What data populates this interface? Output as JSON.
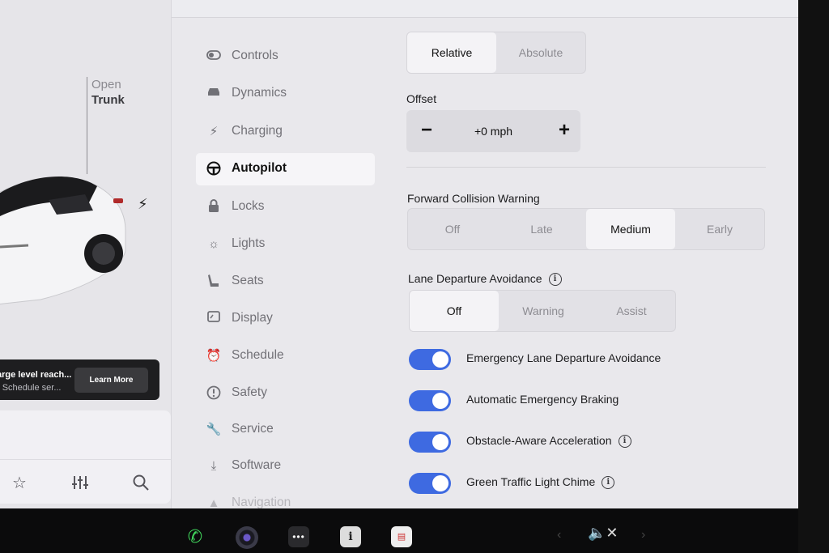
{
  "car_panel": {
    "trunk_status": "Open",
    "trunk_label": "Trunk",
    "notification": {
      "title": "arge level reach...",
      "subtitle": "- Schedule ser...",
      "button": "Learn More"
    },
    "media_icons": [
      "star-icon",
      "equalizer-icon",
      "search-icon"
    ]
  },
  "nav": {
    "items": [
      {
        "label": "Controls",
        "icon": "toggle-icon",
        "active": false
      },
      {
        "label": "Dynamics",
        "icon": "car-icon",
        "active": false
      },
      {
        "label": "Charging",
        "icon": "bolt-icon",
        "active": false
      },
      {
        "label": "Autopilot",
        "icon": "steering-wheel-icon",
        "active": true
      },
      {
        "label": "Locks",
        "icon": "lock-icon",
        "active": false
      },
      {
        "label": "Lights",
        "icon": "light-icon",
        "active": false
      },
      {
        "label": "Seats",
        "icon": "seat-icon",
        "active": false
      },
      {
        "label": "Display",
        "icon": "display-icon",
        "active": false
      },
      {
        "label": "Schedule",
        "icon": "alarm-icon",
        "active": false
      },
      {
        "label": "Safety",
        "icon": "alert-icon",
        "active": false
      },
      {
        "label": "Service",
        "icon": "wrench-icon",
        "active": false
      },
      {
        "label": "Software",
        "icon": "download-icon",
        "active": false
      },
      {
        "label": "Navigation",
        "icon": "navigation-icon",
        "active": false
      }
    ]
  },
  "autopilot": {
    "speed_limit_mode": {
      "options": [
        "Relative",
        "Absolute"
      ],
      "selected": "Relative"
    },
    "offset": {
      "label": "Offset",
      "value": "+0 mph",
      "minus": "−",
      "plus": "+"
    },
    "forward_collision_warning": {
      "label": "Forward Collision Warning",
      "options": [
        "Off",
        "Late",
        "Medium",
        "Early"
      ],
      "selected": "Medium"
    },
    "lane_departure_avoidance": {
      "label": "Lane Departure Avoidance",
      "options": [
        "Off",
        "Warning",
        "Assist"
      ],
      "selected": "Off"
    },
    "toggles": [
      {
        "label": "Emergency Lane Departure Avoidance",
        "on": true,
        "info": false
      },
      {
        "label": "Automatic Emergency Braking",
        "on": true,
        "info": false
      },
      {
        "label": "Obstacle-Aware Acceleration",
        "on": true,
        "info": true
      },
      {
        "label": "Green Traffic Light Chime",
        "on": true,
        "info": true
      }
    ]
  },
  "taskbar": {
    "icons": [
      "phone-icon",
      "camera-icon",
      "more-icon",
      "info-app-icon",
      "calendar-icon"
    ],
    "volume": "muted",
    "more_glyph": "•••",
    "info_glyph": "i"
  },
  "colors": {
    "toggle_on": "#3e6ae1",
    "screen_bg": "#e9e8ec",
    "phone_green": "#3fd15a"
  }
}
